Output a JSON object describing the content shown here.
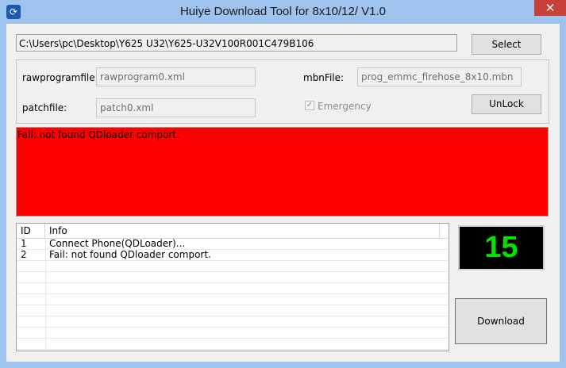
{
  "window": {
    "title": "Huiye Download Tool for 8x10/12/ V1.0",
    "close_symbol": "✕"
  },
  "file_path": "C:\\Users\\pc\\Desktop\\Y625 U32\\Y625-U32V100R001C479B106",
  "buttons": {
    "select": "Select",
    "unlock": "UnLock",
    "download": "Download"
  },
  "settings": {
    "rawprogram_label": "rawprogramfile:",
    "rawprogram_value": "rawprogram0.xml",
    "patch_label": "patchfile:",
    "patch_value": "patch0.xml",
    "mbn_label": "mbnFile:",
    "mbn_value": "prog_emmc_firehose_8x10.mbn",
    "emergency_label": "Emergency",
    "emergency_checked": true
  },
  "status": {
    "message": "Fail: not found QDloader comport.",
    "color": "#ff0000"
  },
  "log": {
    "columns": [
      "ID",
      "Info"
    ],
    "rows": [
      {
        "id": "1",
        "info": "Connect Phone(QDLoader)..."
      },
      {
        "id": "2",
        "info": "Fail: not found QDloader comport."
      }
    ]
  },
  "counter": {
    "value": "15",
    "color": "#00e600"
  }
}
